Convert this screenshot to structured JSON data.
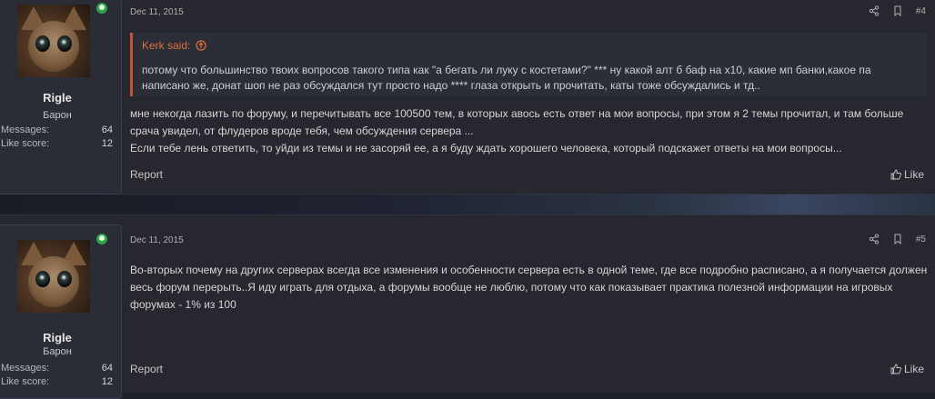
{
  "posts": [
    {
      "user": {
        "name": "Rigle",
        "title": "Барон",
        "messages_label": "Messages:",
        "messages": "64",
        "likes_label": "Like score:",
        "likes": "12"
      },
      "date": "Dec 11, 2015",
      "number": "#4",
      "quote": {
        "author": "Kerk said:",
        "text": "потому что большинство твоих вопросов такого типа как \"а бегать ли луку с костетами?\" *** ну какой алт б баф на х10, какие мп банки,какое па написано же, донат шоп не раз обсуждался тут просто надо **** глаза открыть и прочитать, каты тоже обсуждались и тд.."
      },
      "message_line1": "мне некогда лазить по форуму, и перечитывать все 100500 тем, в которых авось есть ответ на мои вопросы, при этом я 2 темы прочитал, и там больше срача увидел, от флудеров вроде тебя, чем обсуждения сервера ...",
      "message_line2": "Если тебе лень ответить, то уйди из темы и не засоряй ее, а я буду ждать хорошего человека, который подскажет ответы на мои вопросы...",
      "report": "Report",
      "like": "Like"
    },
    {
      "user": {
        "name": "Rigle",
        "title": "Барон",
        "messages_label": "Messages:",
        "messages": "64",
        "likes_label": "Like score:",
        "likes": "12"
      },
      "date": "Dec 11, 2015",
      "number": "#5",
      "message": "Во-вторых почему на других серверах всегда все изменения и особенности сервера есть в одной теме, где все подробно расписано, а я получается должен весь форум перерыть..Я иду играть для отдыха, а форумы вообще не люблю, потому что как показывает практика полезной информации на игровых форумах - 1% из 100",
      "report": "Report",
      "like": "Like"
    }
  ],
  "colors": {
    "accent": "#e0703c",
    "online": "#33a34a",
    "background": "#26272f"
  }
}
